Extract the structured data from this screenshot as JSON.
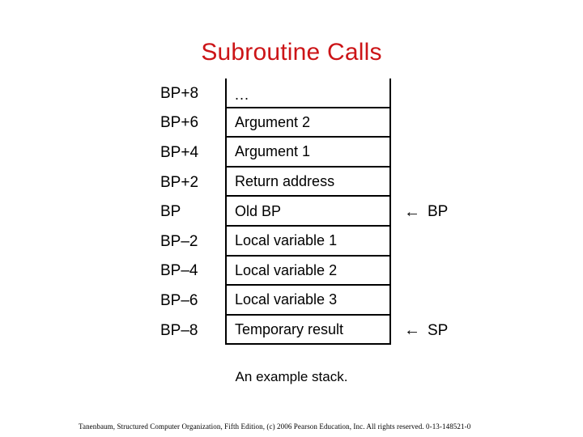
{
  "slide": {
    "title": "Subroutine Calls",
    "title_color": "#CC1417",
    "caption": "An example stack.",
    "footer": "Tanenbaum, Structured Computer Organization, Fifth Edition, (c) 2006 Pearson Education, Inc. All rights reserved. 0-13-148521-0",
    "background_color": "#FFFFFF",
    "text_color": "#000000"
  },
  "stack_diagram": {
    "name": "An example stack.",
    "border_color": "#000000",
    "rows": [
      {
        "offset": "BP+8",
        "content": "...",
        "pointer": "",
        "arrow": ""
      },
      {
        "offset": "BP+6",
        "content": "Argument 2",
        "pointer": "",
        "arrow": ""
      },
      {
        "offset": "BP+4",
        "content": "Argument 1",
        "pointer": "",
        "arrow": ""
      },
      {
        "offset": "BP+2",
        "content": "Return address",
        "pointer": "",
        "arrow": ""
      },
      {
        "offset": "BP",
        "content": "Old BP",
        "pointer": "BP",
        "arrow": "←"
      },
      {
        "offset": "BP–2",
        "content": "Local variable 1",
        "pointer": "",
        "arrow": ""
      },
      {
        "offset": "BP–4",
        "content": "Local variable 2",
        "pointer": "",
        "arrow": ""
      },
      {
        "offset": "BP–6",
        "content": "Local variable 3",
        "pointer": "",
        "arrow": ""
      },
      {
        "offset": "BP–8",
        "content": "Temporary result",
        "pointer": "SP",
        "arrow": "←"
      }
    ]
  }
}
